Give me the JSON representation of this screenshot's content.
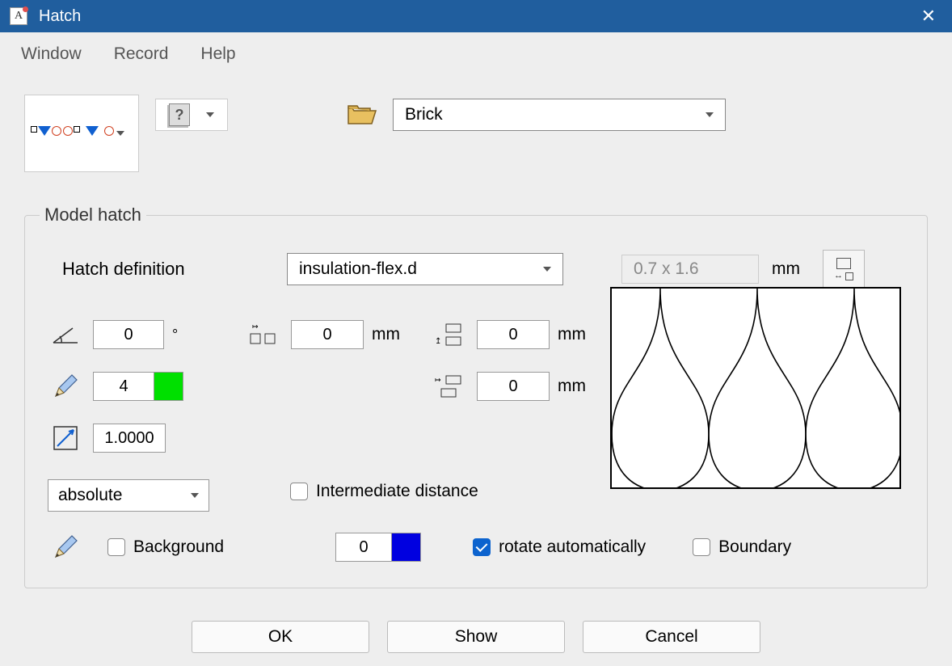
{
  "titlebar": {
    "app_letter": "A",
    "title": "Hatch"
  },
  "menubar": {
    "window": "Window",
    "record": "Record",
    "help": "Help"
  },
  "toolbar": {
    "help_symbol": "?",
    "material_combo": "Brick"
  },
  "groupbox": {
    "legend": "Model hatch",
    "hatch_def_label": "Hatch definition",
    "hatch_def_value": "insulation-flex.d",
    "dimensions_display": "0.7 x 1.6",
    "dimensions_unit": "mm",
    "angle_value": "0",
    "angle_unit": "°",
    "hspacing_value": "0",
    "hspacing_unit": "mm",
    "voffset_value": "0",
    "voffset_unit": "mm",
    "pen_value": "4",
    "pen_color": "#00e000",
    "hoffset_value": "0",
    "hoffset_unit": "mm",
    "scale_value": "1.0000",
    "scale_mode": "absolute",
    "intermediate_label": "Intermediate distance",
    "background_label": "Background",
    "bg_pen_value": "0",
    "bg_pen_color": "#0000e0",
    "rotate_label": "rotate automatically",
    "boundary_label": "Boundary"
  },
  "footer": {
    "ok": "OK",
    "show": "Show",
    "cancel": "Cancel"
  }
}
